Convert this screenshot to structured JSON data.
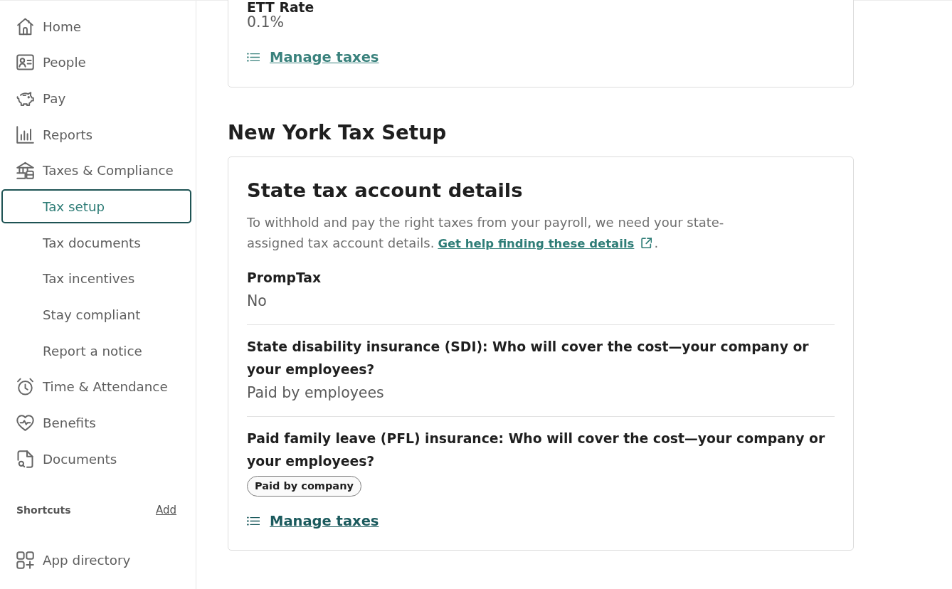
{
  "sidebar": {
    "nav_items": [
      {
        "label": "Home",
        "selected": false
      },
      {
        "label": "People",
        "selected": false
      },
      {
        "label": "Pay",
        "selected": false
      },
      {
        "label": "Reports",
        "selected": false
      },
      {
        "label": "Taxes & Compliance",
        "selected": false,
        "children": [
          {
            "label": "Tax setup",
            "selected": true
          },
          {
            "label": "Tax documents",
            "selected": false
          },
          {
            "label": "Tax incentives",
            "selected": false
          },
          {
            "label": "Stay compliant",
            "selected": false
          },
          {
            "label": "Report a notice",
            "selected": false
          }
        ]
      },
      {
        "label": "Time & Attendance",
        "selected": false
      },
      {
        "label": "Benefits",
        "selected": false
      },
      {
        "label": "Documents",
        "selected": false
      }
    ],
    "shortcuts": {
      "title": "Shortcuts",
      "add_link": "Add"
    },
    "app_directory": {
      "label": "App directory",
      "selected": false
    }
  },
  "main": {
    "previous_card": {
      "fields": [
        {
          "label": "ETT Rate",
          "value": "0.1%",
          "kind": "text"
        }
      ],
      "link": {
        "text": "Manage taxes",
        "hovered": false
      }
    },
    "section_title": "New York Tax Setup",
    "card": {
      "title": "State tax account details",
      "description": {
        "text": "To withhold and pay the right taxes from your payroll, we need your state-assigned tax account details.",
        "link": "Get help finding these details",
        "after": "."
      },
      "fields": [
        {
          "label": "PrompTax",
          "value": "No",
          "kind": "text"
        },
        {
          "label": "State disability insurance (SDI): Who will cover the cost—your company or your employees?",
          "value": "Paid by employees",
          "kind": "text"
        },
        {
          "label": "Paid family leave (PFL) insurance: Who will cover the cost—your company or your employees?",
          "value": "Paid by company",
          "kind": "badge"
        }
      ],
      "link": {
        "text": "Manage taxes",
        "hovered": true
      }
    }
  }
}
